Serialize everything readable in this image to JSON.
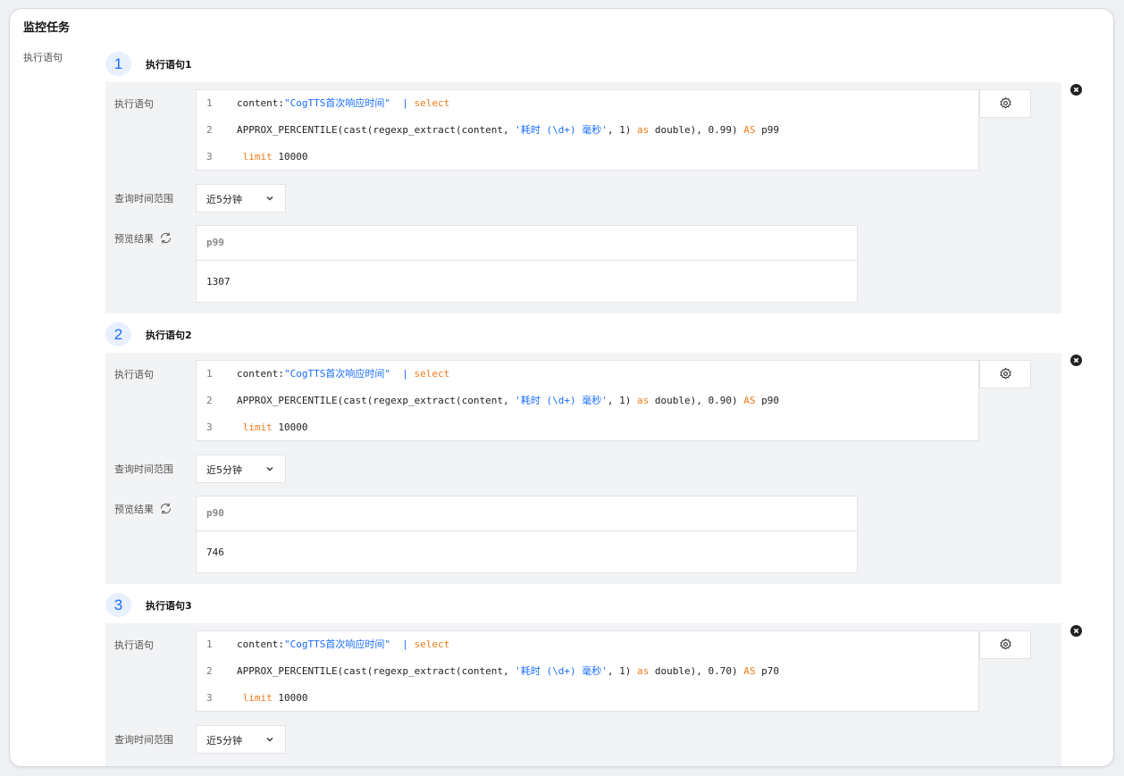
{
  "section_title": "监控任务",
  "field_label": "执行语句",
  "labels": {
    "statement": "执行语句",
    "time_range": "查询时间范围",
    "preview": "预览结果"
  },
  "statements": [
    {
      "index": "1",
      "title": "执行语句1",
      "lines": [
        {
          "n": "1",
          "parts": [
            {
              "t": "content:",
              "c": ""
            },
            {
              "t": "\"CogTTS首次响应时间\"",
              "c": "s-str"
            },
            {
              "t": "  | ",
              "c": "s-str"
            },
            {
              "t": "select",
              "c": "s-kw"
            }
          ]
        },
        {
          "n": "2",
          "parts": [
            {
              "t": "APPROX_PERCENTILE(cast(regexp_extract(content, ",
              "c": ""
            },
            {
              "t": "'耗时 (\\d+) 毫秒'",
              "c": "s-str"
            },
            {
              "t": ", 1) ",
              "c": ""
            },
            {
              "t": "as",
              "c": "s-kw"
            },
            {
              "t": " double), 0.99) ",
              "c": ""
            },
            {
              "t": "AS",
              "c": "s-kw"
            },
            {
              "t": " p99",
              "c": ""
            }
          ]
        },
        {
          "n": "3",
          "parts": [
            {
              "t": " ",
              "c": ""
            },
            {
              "t": "limit",
              "c": "s-kw"
            },
            {
              "t": " 10000",
              "c": ""
            }
          ]
        }
      ],
      "time_range": "近5分钟",
      "result": {
        "column": "p99",
        "value": "1307"
      }
    },
    {
      "index": "2",
      "title": "执行语句2",
      "lines": [
        {
          "n": "1",
          "parts": [
            {
              "t": "content:",
              "c": ""
            },
            {
              "t": "\"CogTTS首次响应时间\"",
              "c": "s-str"
            },
            {
              "t": "  | ",
              "c": "s-str"
            },
            {
              "t": "select",
              "c": "s-kw"
            }
          ]
        },
        {
          "n": "2",
          "parts": [
            {
              "t": "APPROX_PERCENTILE(cast(regexp_extract(content, ",
              "c": ""
            },
            {
              "t": "'耗时 (\\d+) 毫秒'",
              "c": "s-str"
            },
            {
              "t": ", 1) ",
              "c": ""
            },
            {
              "t": "as",
              "c": "s-kw"
            },
            {
              "t": " double), 0.90) ",
              "c": ""
            },
            {
              "t": "AS",
              "c": "s-kw"
            },
            {
              "t": " p90",
              "c": ""
            }
          ]
        },
        {
          "n": "3",
          "parts": [
            {
              "t": " ",
              "c": ""
            },
            {
              "t": "limit",
              "c": "s-kw"
            },
            {
              "t": " 10000",
              "c": ""
            }
          ]
        }
      ],
      "time_range": "近5分钟",
      "result": {
        "column": "p90",
        "value": "746"
      }
    },
    {
      "index": "3",
      "title": "执行语句3",
      "lines": [
        {
          "n": "1",
          "parts": [
            {
              "t": "content:",
              "c": ""
            },
            {
              "t": "\"CogTTS首次响应时间\"",
              "c": "s-str"
            },
            {
              "t": "  | ",
              "c": "s-str"
            },
            {
              "t": "select",
              "c": "s-kw"
            }
          ]
        },
        {
          "n": "2",
          "parts": [
            {
              "t": "APPROX_PERCENTILE(cast(regexp_extract(content, ",
              "c": ""
            },
            {
              "t": "'耗时 (\\d+) 毫秒'",
              "c": "s-str"
            },
            {
              "t": ", 1) ",
              "c": ""
            },
            {
              "t": "as",
              "c": "s-kw"
            },
            {
              "t": " double), 0.70) ",
              "c": ""
            },
            {
              "t": "AS",
              "c": "s-kw"
            },
            {
              "t": " p70",
              "c": ""
            }
          ]
        },
        {
          "n": "3",
          "parts": [
            {
              "t": " ",
              "c": ""
            },
            {
              "t": "limit",
              "c": "s-kw"
            },
            {
              "t": " 10000",
              "c": ""
            }
          ]
        }
      ],
      "time_range": "近5分钟",
      "result": null
    }
  ],
  "icons": {
    "settings": "gear-icon",
    "refresh": "refresh-icon",
    "remove": "close-icon",
    "dropdown": "chevron-down-icon"
  }
}
